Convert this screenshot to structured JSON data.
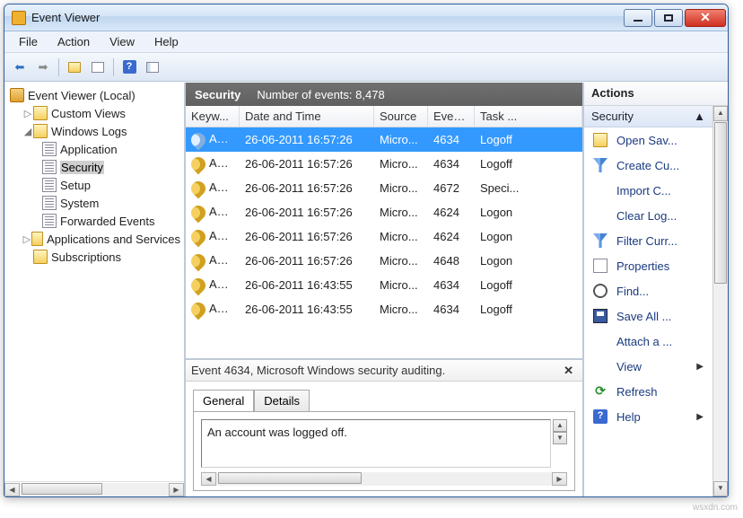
{
  "window": {
    "title": "Event Viewer"
  },
  "menu": {
    "file": "File",
    "action": "Action",
    "view": "View",
    "help": "Help"
  },
  "tree": {
    "root": "Event Viewer (Local)",
    "custom_views": "Custom Views",
    "windows_logs": "Windows Logs",
    "logs": {
      "application": "Application",
      "security": "Security",
      "setup": "Setup",
      "system": "System",
      "forwarded": "Forwarded Events"
    },
    "apps_services": "Applications and Services",
    "subscriptions": "Subscriptions"
  },
  "mid": {
    "title": "Security",
    "count_label": "Number of events: 8,478",
    "columns": {
      "keywords": "Keyw...",
      "datetime": "Date and Time",
      "source": "Source",
      "eventid": "Event...",
      "task": "Task ..."
    },
    "rows": [
      {
        "kw": "Aud...",
        "dt": "26-06-2011 16:57:26",
        "src": "Micro...",
        "id": "4634",
        "task": "Logoff",
        "selected": true
      },
      {
        "kw": "Aud...",
        "dt": "26-06-2011 16:57:26",
        "src": "Micro...",
        "id": "4634",
        "task": "Logoff"
      },
      {
        "kw": "Aud...",
        "dt": "26-06-2011 16:57:26",
        "src": "Micro...",
        "id": "4672",
        "task": "Speci..."
      },
      {
        "kw": "Aud...",
        "dt": "26-06-2011 16:57:26",
        "src": "Micro...",
        "id": "4624",
        "task": "Logon"
      },
      {
        "kw": "Aud...",
        "dt": "26-06-2011 16:57:26",
        "src": "Micro...",
        "id": "4624",
        "task": "Logon"
      },
      {
        "kw": "Aud...",
        "dt": "26-06-2011 16:57:26",
        "src": "Micro...",
        "id": "4648",
        "task": "Logon"
      },
      {
        "kw": "Aud...",
        "dt": "26-06-2011 16:43:55",
        "src": "Micro...",
        "id": "4634",
        "task": "Logoff"
      },
      {
        "kw": "Aud...",
        "dt": "26-06-2011 16:43:55",
        "src": "Micro...",
        "id": "4634",
        "task": "Logoff"
      }
    ],
    "detail": {
      "header": "Event 4634, Microsoft Windows security auditing.",
      "tabs": {
        "general": "General",
        "details": "Details"
      },
      "message": "An account was logged off."
    }
  },
  "actions": {
    "heading": "Actions",
    "group": "Security",
    "items": {
      "open_saved": "Open Sav...",
      "create_custom": "Create Cu...",
      "import_custom": "Import C...",
      "clear_log": "Clear Log...",
      "filter": "Filter Curr...",
      "properties": "Properties",
      "find": "Find...",
      "save_all": "Save All ...",
      "attach": "Attach a ...",
      "view": "View",
      "refresh": "Refresh",
      "help": "Help"
    }
  },
  "watermark": "wsxdn.com"
}
